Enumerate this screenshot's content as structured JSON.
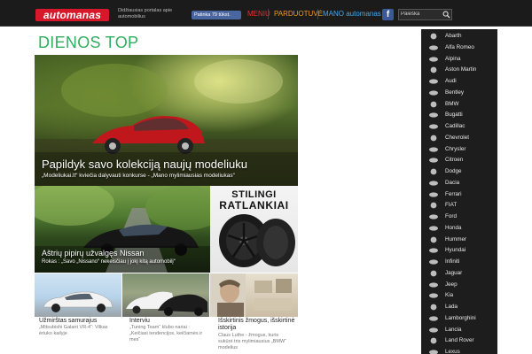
{
  "header": {
    "logo_text": "automanas",
    "tagline": "Didžiausias portalas apie automobilius",
    "fb_like_text": "Patinka 79 tūkst.",
    "nav": [
      {
        "label": "MENIU",
        "color": "#e0312e"
      },
      {
        "label": "PARDUOTUVĖ",
        "color": "#f39a1f"
      },
      {
        "label": "MANO automanas",
        "color": "#49a6e6"
      }
    ],
    "fb_icon_text": "f",
    "search_placeholder": "Paieška"
  },
  "page_title": "DIENOS TOP",
  "featured": {
    "title": "Papildyk savo kolekciją naujų modeliuku",
    "subtitle": "„Modeliukai.lt“ kviečia dalyvauti konkurse - „Mano mylimiausias modeliukas“"
  },
  "nissan": {
    "title": "Aštrių pipirų užvalgęs Nissan",
    "subtitle": "Rokas : „Savo „Nissano“ nekeisčiau į jokį kitą automobilį“"
  },
  "ratlankiai": {
    "line1": "STILINGI",
    "line2": "RATLANKIAI"
  },
  "small_articles": [
    {
      "title": "Užmirštas samurajus",
      "desc": "„Mitsubishi Galant VR-4“: Vilkas ėriuko kailyje"
    },
    {
      "title": "Interviu",
      "desc": "„Tuning Team“ klubo nariai : „Keičiasi tendencijos, keičiamės ir mes“"
    },
    {
      "title": "Išskirtinis žmogus, išskirtinė istorija",
      "desc": "Claus Luthe - žmogus, kuris sukūrė tris mylimiausius „BMW“ modelius"
    }
  ],
  "brands": [
    "Abarth",
    "Alfa Romeo",
    "Alpina",
    "Aston Martin",
    "Audi",
    "Bentley",
    "BMW",
    "Bugatti",
    "Cadillac",
    "Chevrolet",
    "Chrysler",
    "Citroen",
    "Dodge",
    "Dacia",
    "Ferrari",
    "FIAT",
    "Ford",
    "Honda",
    "Hummer",
    "Hyundai",
    "Infiniti",
    "Jaguar",
    "Jeep",
    "Kia",
    "Lada",
    "Lamborghini",
    "Lancia",
    "Land Rover",
    "Lexus"
  ],
  "colors": {
    "accent_green": "#2fae5e",
    "topbar": "#1b1b1b",
    "sidebar": "#1d1d1d",
    "logo_red": "#d7182a"
  }
}
